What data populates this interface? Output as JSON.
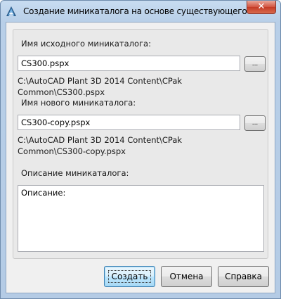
{
  "window": {
    "title": "Создание миникаталога на основе существующего мин...",
    "close_glyph": "✕",
    "app_icon": "autocad-plant-a-icon",
    "accent": "#c43a25"
  },
  "form": {
    "source_label": "Имя исходного миникаталога:",
    "source_value": "CS300.pspx",
    "source_path": "C:\\AutoCAD Plant 3D 2014 Content\\CPak Common\\CS300.pspx",
    "new_label": "Имя нового миникаталога:",
    "new_value": "CS300-copy.pspx",
    "new_path": "C:\\AutoCAD Plant 3D 2014 Content\\CPak Common\\CS300-copy.pspx",
    "browse_label": "...",
    "description_label": "Описание миникаталога:",
    "description_value": "Описание:"
  },
  "buttons": {
    "create": "Создать",
    "cancel": "Отмена",
    "help": "Справка"
  }
}
